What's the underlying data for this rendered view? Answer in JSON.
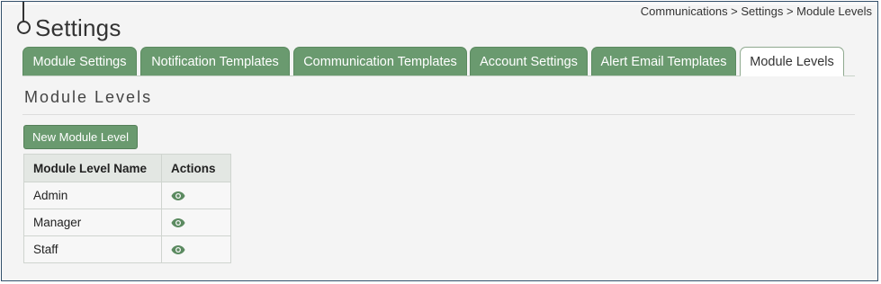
{
  "page": {
    "title": "Settings"
  },
  "breadcrumb": "Communications > Settings > Module Levels",
  "tabs": [
    {
      "label": "Module Settings",
      "active": false
    },
    {
      "label": "Notification Templates",
      "active": false
    },
    {
      "label": "Communication Templates",
      "active": false
    },
    {
      "label": "Account Settings",
      "active": false
    },
    {
      "label": "Alert Email Templates",
      "active": false
    },
    {
      "label": "Module Levels",
      "active": true
    }
  ],
  "section": {
    "title": "Module Levels"
  },
  "new_button": {
    "label": "New Module Level"
  },
  "table": {
    "headers": [
      "Module Level Name",
      "Actions"
    ],
    "rows": [
      {
        "name": "Admin",
        "action_icon": "eye-icon"
      },
      {
        "name": "Manager",
        "action_icon": "eye-icon"
      },
      {
        "name": "Staff",
        "action_icon": "eye-icon"
      }
    ]
  },
  "colors": {
    "accent": "#6a9a6f",
    "frame": "#33506b",
    "icon": "#5b8a60"
  }
}
